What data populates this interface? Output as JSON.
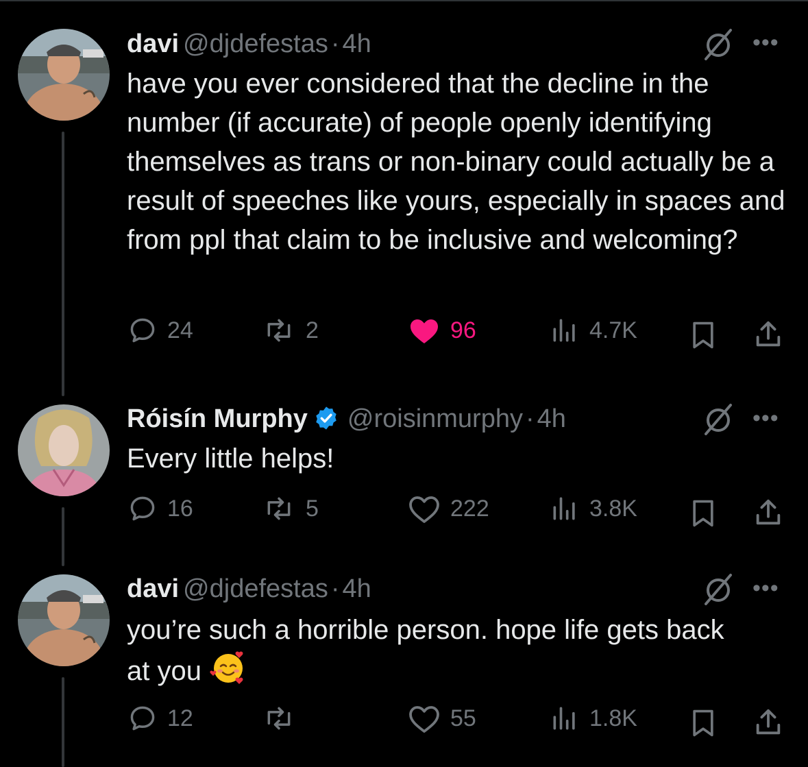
{
  "tweets": [
    {
      "name": "davi",
      "handle": "@djdefestas",
      "time": "4h",
      "text": "have you ever considered that the decline in the number (if accurate) of people openly identifying themselves as trans or non-binary could actually be a result of speeches like yours, especially in spaces and from ppl that claim to be inclusive and welcoming?",
      "replies": "24",
      "reposts": "2",
      "likes": "96",
      "views": "4.7K",
      "liked": true,
      "verified": false
    },
    {
      "name": "Róisín Murphy",
      "handle": "@roisinmurphy",
      "time": "4h",
      "text": "Every little helps!",
      "replies": "16",
      "reposts": "5",
      "likes": "222",
      "views": "3.8K",
      "liked": false,
      "verified": true
    },
    {
      "name": "davi",
      "handle": "@djdefestas",
      "time": "4h",
      "text": "you’re such a horrible person. hope life gets back at you",
      "emoji": "smiling-face-with-hearts",
      "replies": "12",
      "reposts": "",
      "likes": "55",
      "views": "1.8K",
      "liked": false,
      "verified": false
    }
  ],
  "separator": "·",
  "more_label": "•••",
  "icons": {
    "reply": "reply-icon",
    "repost": "repost-icon",
    "like": "heart-icon",
    "views": "views-icon",
    "bookmark": "bookmark-icon",
    "share": "share-icon",
    "grok": "grok-icon",
    "verified": "verified-badge-icon"
  },
  "colors": {
    "background": "#000000",
    "text": "#e7e9ea",
    "muted": "#71767b",
    "like": "#f91880",
    "verified": "#1d9bf0"
  }
}
